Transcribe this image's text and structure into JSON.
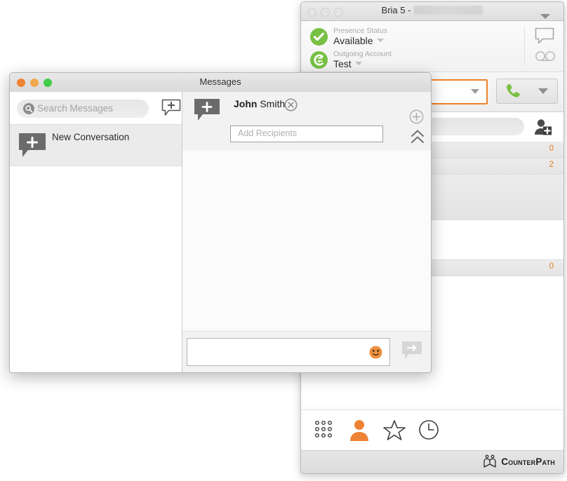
{
  "bria": {
    "title_prefix": "Bria 5 -",
    "title_redacted": "",
    "presence": {
      "label": "Presence Status",
      "value": "Available",
      "icon": "check-circle-icon",
      "color": "#77c043"
    },
    "account": {
      "label": "Outgoing Account",
      "value": "Test",
      "icon": "account-swap-icon",
      "color": "#77c043"
    },
    "rail_icons": [
      {
        "name": "messages-bubble-icon"
      },
      {
        "name": "voicemail-icon"
      },
      {
        "name": "chevron-down-icon"
      }
    ],
    "dial": {
      "value": "",
      "placeholder": "",
      "focus_color": "#ef8127",
      "call_icon": "phone-handset-icon",
      "call_color": "#7ac143",
      "more_icon": "chevron-down-icon"
    },
    "contacts": {
      "search_value": "",
      "add_contact_icon": "add-contact-icon",
      "groups": [
        {
          "count": "0",
          "type": "row"
        },
        {
          "count": "2",
          "type": "row"
        },
        {
          "count": "",
          "type": "tall"
        },
        {
          "count": "",
          "type": "blank"
        },
        {
          "count": "0",
          "type": "row"
        }
      ],
      "count_color": "#e0811f"
    },
    "tabs": [
      {
        "name": "dialpad",
        "icon": "dialpad-icon",
        "active": false
      },
      {
        "name": "contacts",
        "icon": "person-icon",
        "active": true
      },
      {
        "name": "favorites",
        "icon": "star-icon",
        "active": false
      },
      {
        "name": "history",
        "icon": "clock-icon",
        "active": false
      }
    ],
    "footer": {
      "brand": "CounterPath",
      "logo_icon": "counterpath-logo-icon"
    },
    "accent_color": "#ef8127"
  },
  "messages": {
    "title": "Messages",
    "window_controls": [
      {
        "name": "close",
        "color": "#ef8435"
      },
      {
        "name": "minimize",
        "color": "#f0a94f"
      },
      {
        "name": "zoom",
        "color": "#44cc48"
      }
    ],
    "search": {
      "placeholder": "Search Messages",
      "value": "",
      "icon": "search-icon"
    },
    "new_conversation_icon": "new-message-icon",
    "conversations": [
      {
        "label": "New Conversation",
        "icon": "new-message-bubble-icon",
        "selected": true
      }
    ],
    "conversation": {
      "avatar_icon": "new-message-bubble-icon",
      "recipient_first": "John",
      "recipient_last": "Smith",
      "remove_icon": "remove-circle-icon",
      "add_recipients_placeholder": "Add Recipients",
      "add_recipients_value": "",
      "add_button_icon": "plus-circle-icon",
      "collapse_icon": "chevron-double-up-icon",
      "compose_value": "",
      "compose_placeholder": "",
      "emoji_icon": "emoji-smiley-icon",
      "send_icon": "send-arrow-icon"
    }
  }
}
